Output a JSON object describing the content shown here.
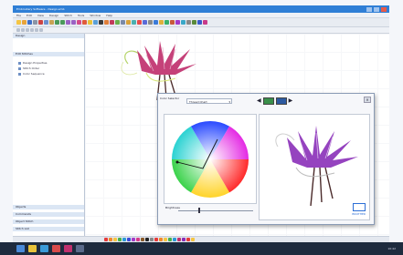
{
  "window": {
    "title": "Embroidery Software - Design.emb"
  },
  "menu": [
    "File",
    "Edit",
    "View",
    "Design",
    "Stitch",
    "Tools",
    "Window",
    "Help"
  ],
  "left_panel": {
    "sections": [
      "Design",
      "Edit Stitches",
      "Objects",
      "Commands",
      "Object Stitch",
      "Stitch List"
    ],
    "items": [
      "Design Properties",
      "Stitch Order",
      "Color Sequence"
    ]
  },
  "dialog": {
    "label": "Color Selector",
    "select_value": "Thread Chart",
    "slider_label": "Brightness",
    "swatch_color": "#3a8f4a",
    "logo_text": "BROTHER"
  },
  "taskbar": {
    "time": "10:42"
  },
  "colors": {
    "accent": "#2f7fd6",
    "design_pink": "#c0316e",
    "design_purple": "#8a2fb8",
    "stem_dark": "#4a2a2a"
  }
}
